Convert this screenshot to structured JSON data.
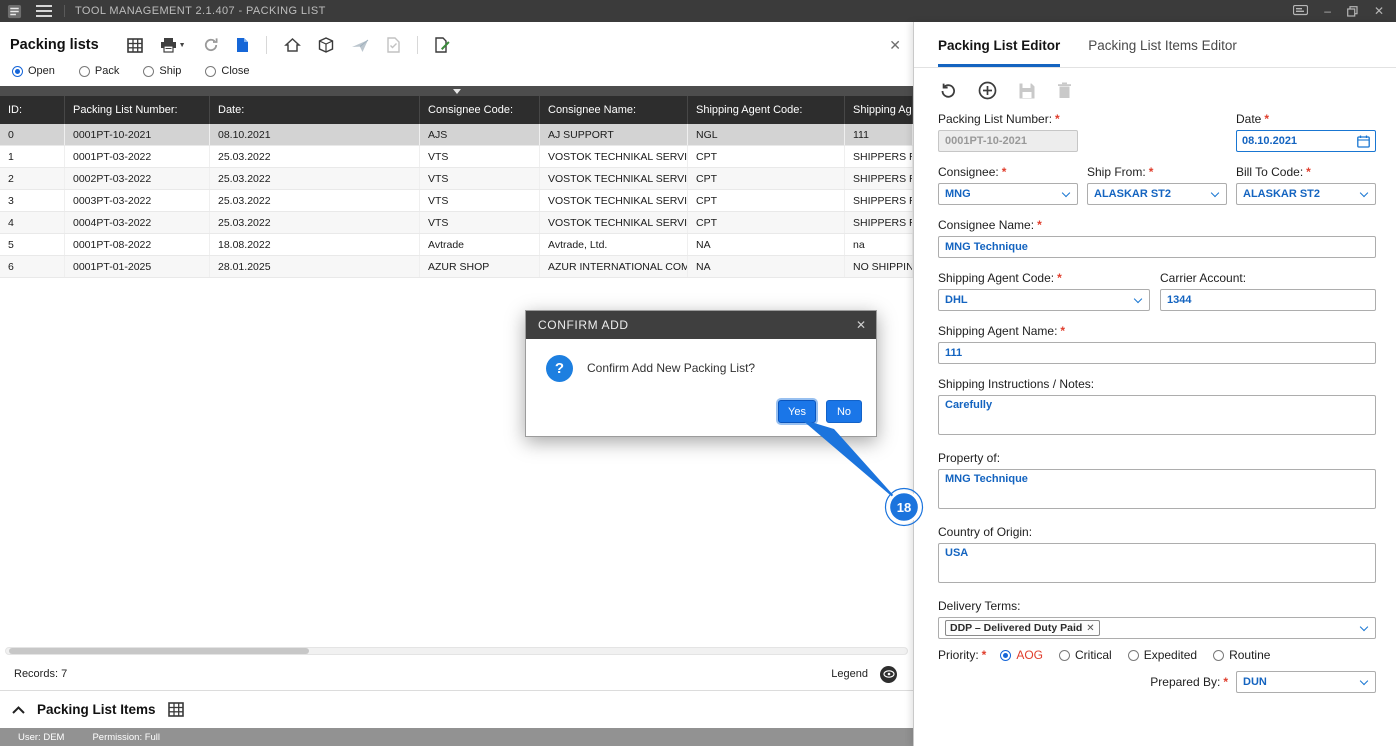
{
  "icons": {
    "close": "✕",
    "caret_down": "▼",
    "minimize": "–",
    "star": "*"
  },
  "colors": {
    "accent_blue": "#1565d8",
    "value_text_blue": "#1464c0",
    "required_red": "#e03e2d",
    "annotation_blue": "#1b74dd",
    "titlebar_bg": "#3b3b3b",
    "table_header_bg": "#2d2d2d"
  },
  "titlebar": {
    "title": "TOOL MANAGEMENT 2.1.407 - PACKING LIST"
  },
  "left": {
    "title": "Packing lists",
    "radios": [
      {
        "label": "Open",
        "selected": true
      },
      {
        "label": "Pack",
        "selected": false
      },
      {
        "label": "Ship",
        "selected": false
      },
      {
        "label": "Close",
        "selected": false
      }
    ],
    "table": {
      "columns": [
        "ID:",
        "Packing List Number:",
        "Date:",
        "Consignee Code:",
        "Consignee Name:",
        "Shipping Agent Code:",
        "Shipping Age"
      ],
      "selected_row": 0,
      "rows": [
        [
          "0",
          "0001PT-10-2021",
          "08.10.2021",
          "AJS",
          "AJ SUPPORT",
          "NGL",
          "111"
        ],
        [
          "1",
          "0001PT-03-2022",
          "25.03.2022",
          "VTS",
          "VOSTOK TECHNIKAL SERVICES",
          "CPT",
          "SHIPPERS RESPO"
        ],
        [
          "2",
          "0002PT-03-2022",
          "25.03.2022",
          "VTS",
          "VOSTOK TECHNIKAL SERVICES",
          "CPT",
          "SHIPPERS RESPO"
        ],
        [
          "3",
          "0003PT-03-2022",
          "25.03.2022",
          "VTS",
          "VOSTOK TECHNIKAL SERVICES",
          "CPT",
          "SHIPPERS RESPO"
        ],
        [
          "4",
          "0004PT-03-2022",
          "25.03.2022",
          "VTS",
          "VOSTOK TECHNIKAL SERVICES",
          "CPT",
          "SHIPPERS RESPO"
        ],
        [
          "5",
          "0001PT-08-2022",
          "18.08.2022",
          "Avtrade",
          "Avtrade, Ltd.",
          "NA",
          "na"
        ],
        [
          "6",
          "0001PT-01-2025",
          "28.01.2025",
          "AZUR SHOP",
          "AZUR INTERNATIONAL COMP...",
          "NA",
          "NO SHIPPING A"
        ]
      ]
    },
    "records_label": "Records: 7",
    "legend_label": "Legend",
    "items_section_title": "Packing List Items"
  },
  "statusbar": {
    "user": "User: DEM",
    "permission": "Permission: Full"
  },
  "dialog": {
    "title": "CONFIRM ADD",
    "message": "Confirm Add New Packing List?",
    "yes_label": "Yes",
    "no_label": "No"
  },
  "annotation": {
    "step": "18"
  },
  "editor": {
    "tabs": [
      {
        "label": "Packing List Editor",
        "active": true
      },
      {
        "label": "Packing List Items Editor",
        "active": false
      }
    ],
    "fields": {
      "packing_list_number": {
        "label": "Packing List Number:",
        "value": "0001PT-10-2021"
      },
      "date": {
        "label": "Date",
        "value": "08.10.2021"
      },
      "consignee": {
        "label": "Consignee:",
        "value": "MNG"
      },
      "ship_from": {
        "label": "Ship From:",
        "value": "ALASKAR ST2"
      },
      "bill_to_code": {
        "label": "Bill To Code:",
        "value": "ALASKAR ST2"
      },
      "consignee_name": {
        "label": "Consignee Name:",
        "value": "MNG Technique"
      },
      "shipping_agent_code": {
        "label": "Shipping Agent Code:",
        "value": "DHL"
      },
      "carrier_account": {
        "label": "Carrier Account:",
        "value": "1344"
      },
      "shipping_agent_name": {
        "label": "Shipping Agent Name:",
        "value": "111"
      },
      "shipping_instructions": {
        "label": "Shipping Instructions / Notes:",
        "value": "Carefully"
      },
      "property_of": {
        "label": "Property of:",
        "value": "MNG Technique"
      },
      "country_of_origin": {
        "label": "Country of Origin:",
        "value": "USA"
      },
      "delivery_terms": {
        "label": "Delivery Terms:",
        "chip": "DDP – Delivered Duty Paid"
      },
      "priority": {
        "label": "Priority:",
        "options": [
          "AOG",
          "Critical",
          "Expedited",
          "Routine"
        ],
        "selected": "AOG"
      },
      "prepared_by": {
        "label": "Prepared By:",
        "value": "DUN"
      }
    }
  }
}
